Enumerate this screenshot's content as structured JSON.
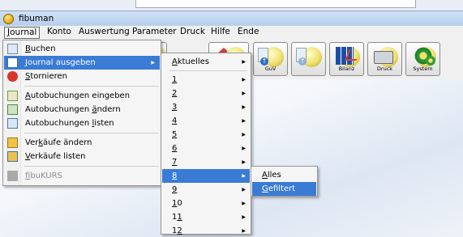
{
  "window": {
    "title": "fibuman"
  },
  "menubar": [
    "Journal",
    "Konto",
    "Auswertung",
    "Parameter",
    "Druck",
    "Hilfe",
    "Ende"
  ],
  "toolbar": {
    "buttons": [
      {
        "icon": "journal-icon",
        "label": ""
      },
      {
        "icon": "home-icon",
        "label": ""
      },
      {
        "icon": "guv-icon",
        "label": "GuV"
      },
      {
        "icon": "document-upload-icon",
        "label": ""
      },
      {
        "icon": "bilanz-icon",
        "label": "Bilanz"
      },
      {
        "icon": "printer-icon",
        "label": "Druck"
      },
      {
        "icon": "gear-icon",
        "label": "System"
      }
    ]
  },
  "journal_menu": {
    "items": [
      {
        "label": "Buchen",
        "icon": "book-icon",
        "submenu": false,
        "highlighted": false,
        "disabled": false
      },
      {
        "label": "Journal ausgeben",
        "icon": "journal-print-icon",
        "submenu": true,
        "highlighted": true,
        "disabled": false
      },
      {
        "label": "Stornieren",
        "icon": "cancel-icon",
        "submenu": false,
        "highlighted": false,
        "disabled": false
      },
      {
        "label": "Autobuchungen eingeben",
        "icon": "add-icon",
        "submenu": false,
        "highlighted": false,
        "disabled": false
      },
      {
        "label": "Autobuchungen ändern",
        "icon": "edit-icon",
        "submenu": false,
        "highlighted": false,
        "disabled": false
      },
      {
        "label": "Autobuchungen listen",
        "icon": "list-icon",
        "submenu": false,
        "highlighted": false,
        "disabled": false
      },
      {
        "label": "Verkäufe ändern",
        "icon": "sales-edit-icon",
        "submenu": false,
        "highlighted": false,
        "disabled": false
      },
      {
        "label": "Verkäufe listen",
        "icon": "sales-list-icon",
        "submenu": false,
        "highlighted": false,
        "disabled": false
      },
      {
        "label": "fibuKURS",
        "icon": "course-icon",
        "submenu": false,
        "highlighted": false,
        "disabled": true
      }
    ]
  },
  "period_menu": {
    "items": [
      "Aktuelles",
      "1",
      "2",
      "3",
      "4",
      "5",
      "6",
      "7",
      "8",
      "9",
      "10",
      "11",
      "12"
    ],
    "highlighted": "8"
  },
  "filter_menu": {
    "items": [
      "Alles",
      "Gefiltert"
    ],
    "highlighted": "Gefiltert"
  },
  "colors": {
    "highlight": "#3a7bd5",
    "titlebar": "#c4d8f0"
  }
}
